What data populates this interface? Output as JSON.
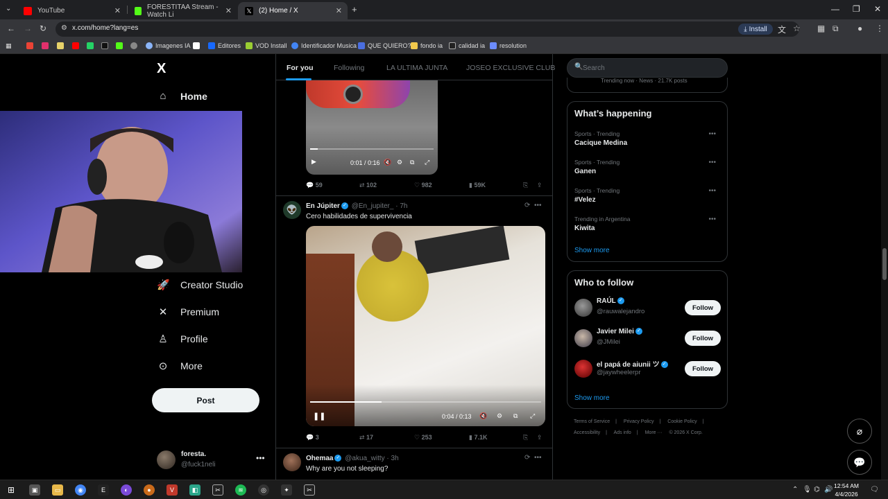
{
  "browser": {
    "tabs": [
      {
        "title": "YouTube",
        "color": "#ff0000"
      },
      {
        "title": "FORESTITAA Stream - Watch Li",
        "color": "#53fc18"
      },
      {
        "title": "(2) Home / X",
        "color": "#ffffff"
      }
    ],
    "url": "x.com/home?lang=es",
    "install_label": "Install",
    "bookmarks": [
      {
        "label": "Imagenes IA",
        "color": "#8ab4f8"
      },
      {
        "label": "Editores",
        "color": "#1769ff"
      },
      {
        "label": "VOD Install",
        "color": "#9acd32"
      },
      {
        "label": "Identificador Musica",
        "color": "#4285f4"
      },
      {
        "label": "QUE QUIERO?",
        "color": "#4a6ee0"
      },
      {
        "label": "fondo ia",
        "color": "#f2c94c"
      },
      {
        "label": "calidad ia",
        "color": "#222222"
      },
      {
        "label": "resolution",
        "color": "#6c8cff"
      }
    ]
  },
  "nav": {
    "logo": "X",
    "items": [
      {
        "label": "Home",
        "icon": "home-icon"
      },
      {
        "label": "Creator Studio",
        "icon": "rocket-icon"
      },
      {
        "label": "Premium",
        "icon": "x-icon"
      },
      {
        "label": "Profile",
        "icon": "person-icon"
      },
      {
        "label": "More",
        "icon": "more-circle-icon"
      }
    ],
    "post_label": "Post",
    "account": {
      "name": "foresta.",
      "handle": "@fuck1neli"
    }
  },
  "timeline": {
    "tabs": [
      "For you",
      "Following",
      "LA ULTIMA JUNTA",
      "JOSEO EXCLUSIVE CLUB"
    ],
    "video1": {
      "time": "0:01 / 0:16",
      "progress": 0.06
    },
    "post0_actions": {
      "replies": "59",
      "reposts": "102",
      "likes": "982",
      "views": "59K"
    },
    "post1": {
      "name": "En Júpiter",
      "meta": "@En_jupiter_ · 7h",
      "text": "Cero habilidades de supervivencia",
      "video_time": "0:04 / 0:13",
      "progress": 0.31,
      "actions": {
        "replies": "3",
        "reposts": "17",
        "likes": "253",
        "views": "7.1K"
      }
    },
    "post2": {
      "name": "Ohemaa",
      "meta": "@akua_witty · 3h",
      "text": "Why are you not sleeping?"
    }
  },
  "sidebar": {
    "search_placeholder": "Search",
    "trend_top": "Trending now · News · 21.7K posts",
    "happening_title": "What’s happening",
    "trends": [
      {
        "category": "Sports · Trending",
        "title": "Cacique Medina"
      },
      {
        "category": "Sports · Trending",
        "title": "Ganen"
      },
      {
        "category": "Sports · Trending",
        "title": "#Velez"
      },
      {
        "category": "Trending in Argentina",
        "title": "Kiwita"
      }
    ],
    "show_more": "Show more",
    "wtf_title": "Who to follow",
    "follow_label": "Follow",
    "who_to_follow": [
      {
        "name": "RAÚL",
        "handle": "@rauwalejandro"
      },
      {
        "name": "Javier Milei",
        "handle": "@JMilei"
      },
      {
        "name": "el papá de aiunii ツ",
        "handle": "@jaywheelerpr"
      }
    ],
    "footer": [
      "Terms of Service",
      "|",
      "Privacy Policy",
      "|",
      "Cookie Policy",
      "|",
      "Accessibility",
      "|",
      "Ads info",
      "|",
      "More ···",
      "© 2026 X Corp."
    ]
  },
  "taskbar": {
    "time": "12:54 AM",
    "date": "4/4/2026"
  }
}
